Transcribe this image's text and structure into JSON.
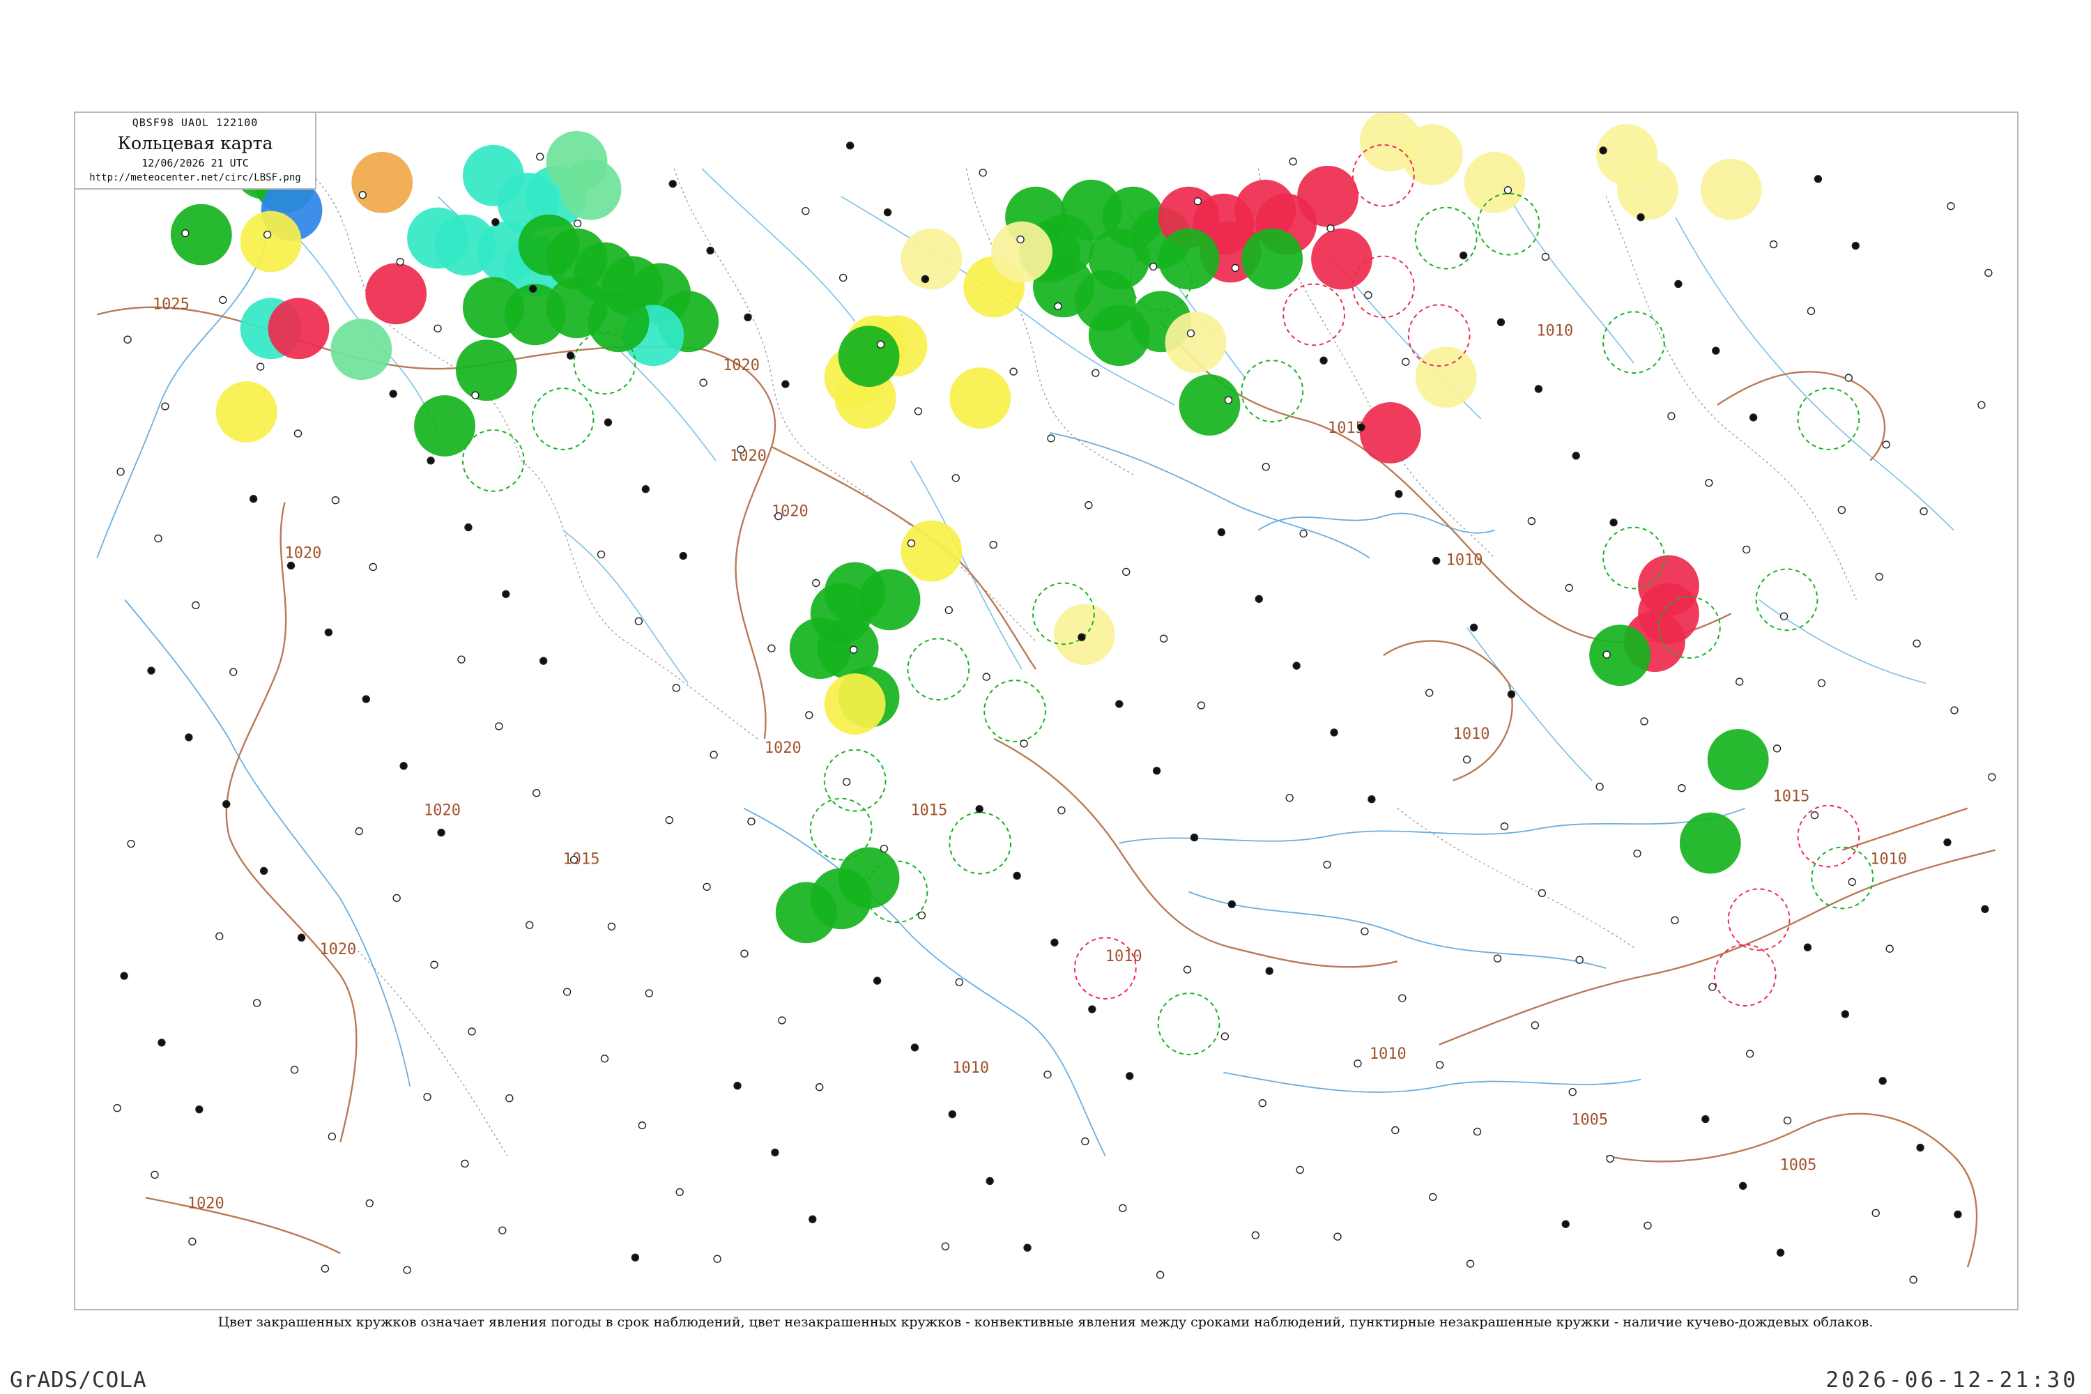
{
  "header": {
    "codes": "QBSF98  UAOL  122100",
    "title": "Кольцевая карта",
    "time": "12/06/2026 21 UTC",
    "url": "http://meteocenter.net/circ/LBSF.png"
  },
  "isobar_labels": [
    "1025",
    "1020",
    "1020",
    "1020",
    "1020",
    "1020",
    "1020",
    "1020",
    "1020",
    "1015",
    "1015",
    "1015",
    "1015",
    "1010",
    "1010",
    "1010",
    "1010",
    "1010",
    "1010",
    "1010",
    "1005",
    "1005"
  ],
  "caption": "Цвет закрашенных кружков означает явления погоды в срок наблюдений, цвет незакрашенных кружков - конвективные явления между сроками наблюдений, пунктирные незакрашенные кружки - наличие кучево-дождевых облаков.",
  "footer": {
    "left": "GrADS/COLA",
    "right": "2026-06-12-21:30"
  },
  "colors": {
    "green": "#15b31e",
    "red": "#ee2a4e",
    "yellow": "#f7f04a",
    "light_yellow": "#faf39a",
    "cyan": "#33e8c6",
    "light_green": "#6fe39a",
    "orange": "#f0a84a",
    "blue": "#2e86e8",
    "isobar": "#b97a55",
    "water": "#7bbfe8"
  }
}
